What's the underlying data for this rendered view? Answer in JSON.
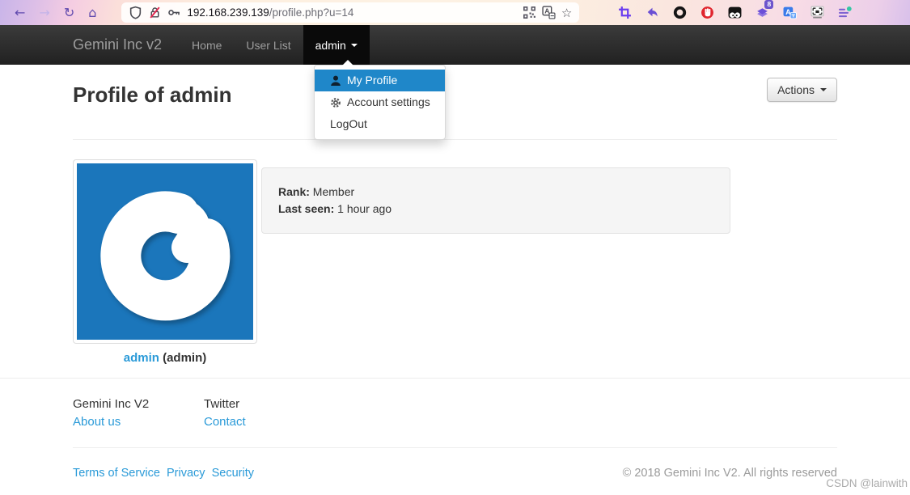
{
  "browser": {
    "url": {
      "host": "192.168.239.139",
      "path": "/profile.php?u=14"
    },
    "extension_badge": "8"
  },
  "navbar": {
    "brand": "Gemini Inc v2",
    "items": [
      {
        "label": "Home"
      },
      {
        "label": "User List"
      }
    ],
    "user_menu_label": "admin"
  },
  "dropdown": {
    "items": [
      {
        "label": "My Profile",
        "icon": "user-icon",
        "active": true
      },
      {
        "label": "Account settings",
        "icon": "gear-icon",
        "active": false
      },
      {
        "label": "LogOut",
        "icon": null,
        "active": false
      }
    ]
  },
  "page": {
    "title": "Profile of admin",
    "actions_label": "Actions",
    "profile": {
      "username": "admin",
      "display_suffix": "(admin)",
      "rank_label": "Rank:",
      "rank_value": "Member",
      "last_seen_label": "Last seen:",
      "last_seen_value": "1 hour ago"
    }
  },
  "footer": {
    "columns": [
      {
        "heading": "Gemini Inc V2",
        "link": "About us"
      },
      {
        "heading": "Twitter",
        "link": "Contact"
      }
    ],
    "legal_links": [
      "Terms of Service",
      "Privacy",
      "Security"
    ],
    "copyright": "© 2018 Gemini Inc V2. All rights reserved",
    "watermark": "CSDN @lainwith"
  },
  "colors": {
    "toolbar_purple": "#6a4fd4",
    "navbar_dark": "#222222",
    "link_blue": "#2a9ad8",
    "dropdown_active_bg": "#1f87c9",
    "avatar_bg": "#1b76bb",
    "well_bg": "#f5f5f5"
  }
}
